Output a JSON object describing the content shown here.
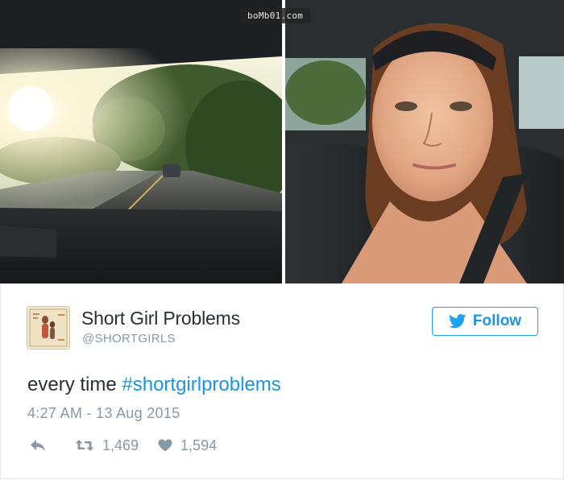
{
  "watermark": {
    "text": "boMb01.com"
  },
  "photos": {
    "left": {
      "subject": "sun glare through car windshield on road"
    },
    "right": {
      "subject": "selfie of woman in car seat with sun on face"
    }
  },
  "tweet": {
    "author_name": "Short Girl Problems",
    "author_handle": "@SHORTGIRLS",
    "follow_label": "Follow",
    "text_plain": "every time ",
    "text_hashtag": "#shortgirlproblems",
    "timestamp": "4:27 AM - 13 Aug 2015",
    "retweet_count": "1,469",
    "like_count": "1,594"
  },
  "colors": {
    "accent": "#1b95e0",
    "text": "#292f33",
    "muted": "#8899a6",
    "border": "#e1e8ed"
  },
  "icons": [
    "reply-icon",
    "retweet-icon",
    "heart-icon",
    "twitter-bird-icon"
  ]
}
